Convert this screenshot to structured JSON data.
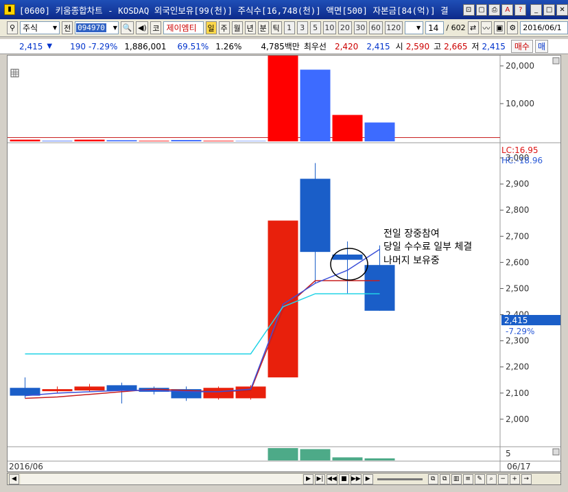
{
  "window": {
    "title": "[0600] 키움종합차트 - KOSDAQ 외국인보유[99(천)] 주식수[16,748(천)] 액면[500] 자본금[84(억)] 결",
    "app_icon": "chart-app-icon"
  },
  "toolbar": {
    "market_type": "주식",
    "prev_label": "전",
    "stock_code": "094970",
    "stock_name_prefix": "코",
    "stock_name": "제이엠티",
    "period_buttons": [
      "일",
      "주",
      "월",
      "년",
      "분",
      "틱"
    ],
    "interval_buttons": [
      "1",
      "3",
      "5",
      "10",
      "20",
      "30",
      "60",
      "120"
    ],
    "active_period": "일",
    "count_value": "14",
    "count_total": "/ 602",
    "date_value": "2016/06/1"
  },
  "info": {
    "price": "2,415",
    "direction_icon": "down-triangle-icon",
    "change": "190",
    "change_pct": "-7.29%",
    "volume": "1,886,001",
    "volume_ratio": "69.51%",
    "turnover": "1.26%",
    "amount": "4,785백만",
    "best_label": "최우선",
    "best_ask": "2,420",
    "best_bid": "2,415",
    "open_label": "시",
    "open": "2,590",
    "high_label": "고",
    "high": "2,665",
    "low_label": "저",
    "low": "2,415",
    "buy_button": "매수",
    "sell_button": "매"
  },
  "top_panel": {
    "ticks": [
      "20,000",
      "10,000"
    ]
  },
  "price_panel": {
    "lc_label": "LC:16.95",
    "hc_label": "HC:-18.96",
    "current_price": "2,415",
    "current_pct": "-7.29%",
    "annotation": [
      "전일 장중참여",
      "당일 수수료 일부 체결",
      "나머지 보유중"
    ]
  },
  "volume_panel": {
    "tick": "5"
  },
  "x_axis": {
    "start_label": "2016/06",
    "end_label": "06/17"
  },
  "colors": {
    "up": "#e8200c",
    "down": "#1a5ec8",
    "net_buy": "#ff0000",
    "net_sell": "#3d6bff",
    "ma_cyan": "#22d3e6"
  },
  "chart_data": {
    "type": "candlestick",
    "y_ticks": [
      2000,
      2100,
      2200,
      2300,
      2400,
      2500,
      2600,
      2700,
      2800,
      2900,
      3000
    ],
    "ylim": [
      1900,
      3050
    ],
    "candles": [
      {
        "open": 2120,
        "close": 2090,
        "high": 2160,
        "low": 2080
      },
      {
        "open": 2110,
        "close": 2115,
        "high": 2125,
        "low": 2100
      },
      {
        "open": 2110,
        "close": 2125,
        "high": 2135,
        "low": 2105
      },
      {
        "open": 2130,
        "close": 2110,
        "high": 2140,
        "low": 2060
      },
      {
        "open": 2120,
        "close": 2105,
        "high": 2125,
        "low": 2095
      },
      {
        "open": 2115,
        "close": 2080,
        "high": 2125,
        "low": 2070
      },
      {
        "open": 2080,
        "close": 2120,
        "high": 2125,
        "low": 2075
      },
      {
        "open": 2080,
        "close": 2125,
        "high": 2130,
        "low": 2075
      },
      {
        "open": 2160,
        "close": 2760,
        "high": 2760,
        "low": 2160
      },
      {
        "open": 2920,
        "close": 2640,
        "high": 2980,
        "low": 2520
      },
      {
        "open": 2630,
        "close": 2610,
        "high": 2680,
        "low": 2480
      },
      {
        "open": 2590,
        "close": 2415,
        "high": 2665,
        "low": 2415
      }
    ],
    "ma_lines": [
      {
        "name": "MA-red",
        "color": "#c81e1e",
        "values": [
          2080,
          2085,
          2095,
          2105,
          2115,
          2110,
          2105,
          2110,
          2420,
          2530,
          2530,
          2530
        ]
      },
      {
        "name": "MA-blue",
        "color": "#3a4fd8",
        "values": [
          2090,
          2100,
          2105,
          2110,
          2110,
          2105,
          2105,
          2115,
          2440,
          2520,
          2570,
          2650
        ]
      },
      {
        "name": "MA-cyan",
        "color": "#22d3e6",
        "values": [
          2250,
          2250,
          2250,
          2250,
          2250,
          2250,
          2250,
          2250,
          2430,
          2480,
          2480,
          2480
        ]
      }
    ],
    "foreign_net": [
      450,
      150,
      450,
      300,
      150,
      350,
      150,
      100,
      24000,
      19000,
      7000,
      5000
    ],
    "foreign_ylim": [
      0,
      22000
    ],
    "volume": [
      0,
      0,
      0,
      0,
      0,
      0,
      0,
      0,
      6,
      5.5,
      1.5,
      1
    ],
    "volume_ylim": [
      0,
      6
    ],
    "volume_color": "#4daa88"
  }
}
